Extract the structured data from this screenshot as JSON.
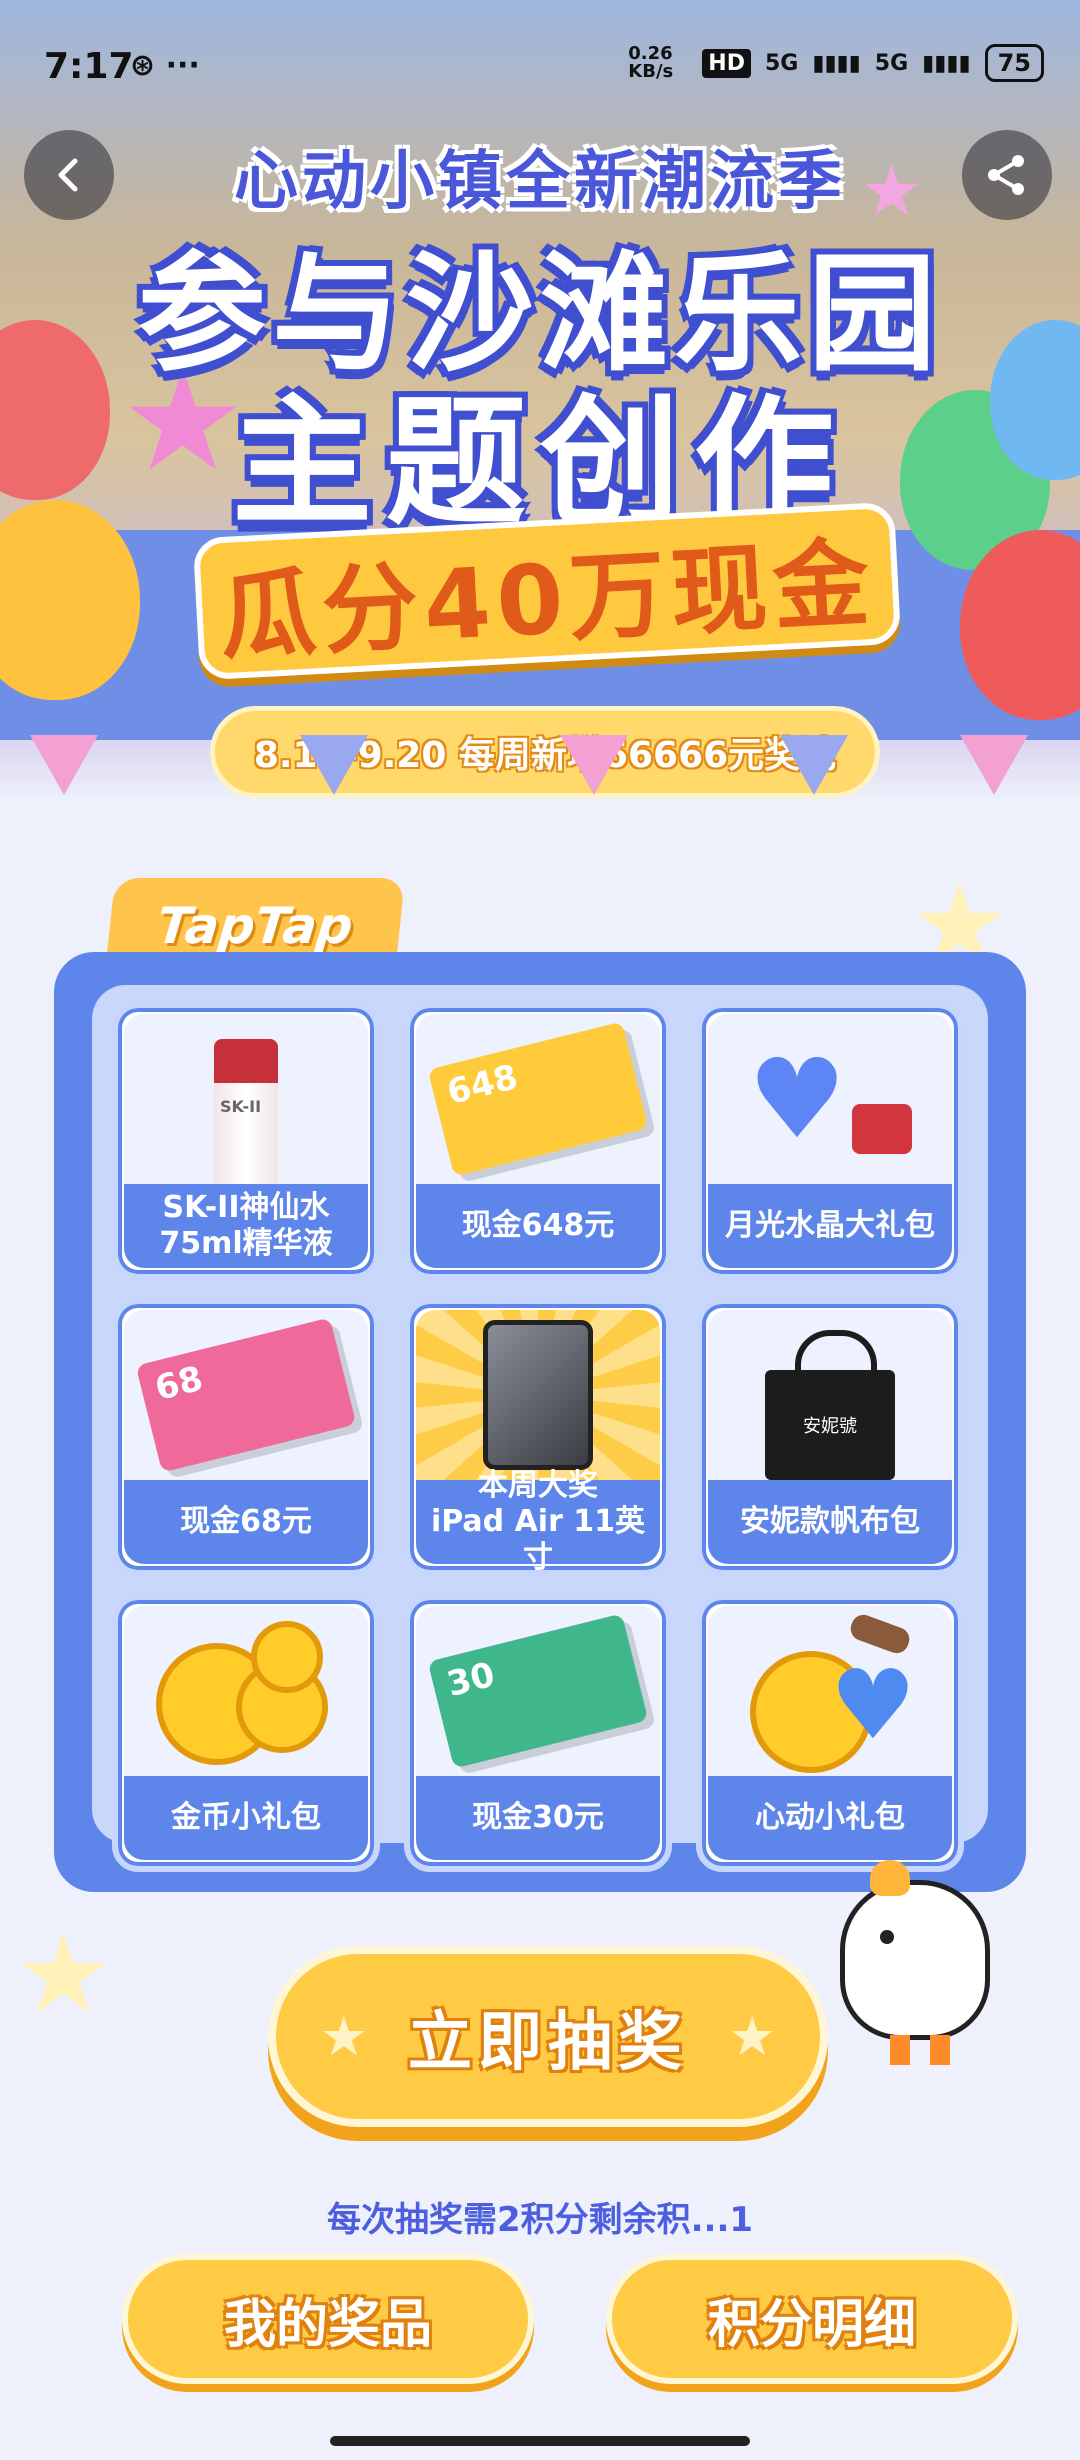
{
  "status_bar": {
    "time": "7:17",
    "extra_icons": "⊛ ···",
    "net_speed": "0.26 KB/s",
    "hd": "HD",
    "signal1": "5G",
    "signal2": "5G",
    "battery": "75"
  },
  "hero": {
    "title_line1": "心动小镇全新潮流季",
    "title_line2": "参与沙滩乐园",
    "title_line3": "主题创作",
    "title_line4": "瓜分40万现金",
    "date_text": "8.10-9.20 每周新增66666元奖池"
  },
  "brand_tab": "TapTap",
  "prizes": [
    {
      "line1": "SK-II神仙水",
      "line2": "75ml精华液",
      "icon": "skii-bottle"
    },
    {
      "line1": "现金648元",
      "line2": "",
      "icon": "ticket-648",
      "ticket_value": "648"
    },
    {
      "line1": "月光水晶大礼包",
      "line2": "",
      "icon": "crystal-gift"
    },
    {
      "line1": "现金68元",
      "line2": "",
      "icon": "ticket-68",
      "ticket_value": "68"
    },
    {
      "line1": "本周大奖",
      "line2": "iPad Air 11英寸",
      "icon": "ipad"
    },
    {
      "line1": "安妮款帆布包",
      "line2": "",
      "icon": "tote-bag",
      "bag_text": "安妮號"
    },
    {
      "line1": "金币小礼包",
      "line2": "",
      "icon": "gold-coins"
    },
    {
      "line1": "现金30元",
      "line2": "",
      "icon": "ticket-30",
      "ticket_value": "30"
    },
    {
      "line1": "心动小礼包",
      "line2": "",
      "icon": "heart-gift"
    }
  ],
  "draw_button": "立即抽奖",
  "note": "每次抽奖需2积分剩余积...1",
  "my_prizes_button": "我的奖品",
  "points_detail_button": "积分明细",
  "colors": {
    "primary_blue": "#5e86ea",
    "button_yellow": "#ffcb45",
    "title_blue": "#3f4fd0",
    "accent_orange": "#e05a1a"
  }
}
